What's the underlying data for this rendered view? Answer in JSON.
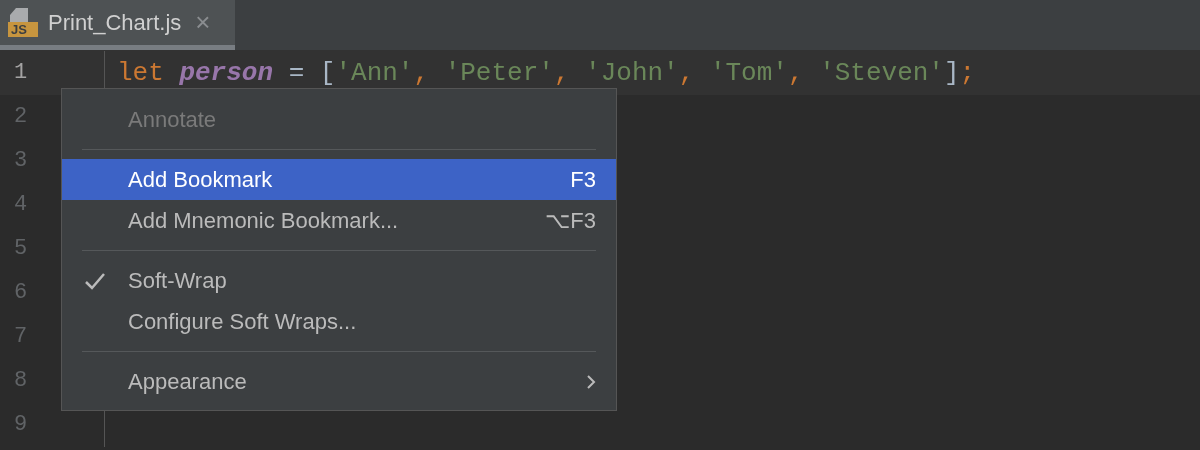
{
  "tabs": [
    {
      "badge": "JS",
      "label": "Print_Chart.js",
      "selected": true,
      "close": "×"
    }
  ],
  "editor": {
    "lines": [
      {
        "number": "1",
        "current": true,
        "tokens": [
          {
            "kind": "keyword",
            "text": "let"
          },
          {
            "kind": "variable",
            "text": "person"
          },
          {
            "kind": "operator",
            "text": "="
          },
          {
            "kind": "bracket",
            "text": "["
          },
          {
            "kind": "string",
            "text": "'Ann'"
          },
          {
            "kind": "comma",
            "text": ","
          },
          {
            "kind": "string",
            "text": "'Peter'"
          },
          {
            "kind": "comma",
            "text": ","
          },
          {
            "kind": "string",
            "text": "'John'"
          },
          {
            "kind": "comma",
            "text": ","
          },
          {
            "kind": "string",
            "text": "'Tom'"
          },
          {
            "kind": "comma",
            "text": ","
          },
          {
            "kind": "string",
            "text": "'Steven'"
          },
          {
            "kind": "bracket",
            "text": "]"
          },
          {
            "kind": "semicolon",
            "text": ";"
          }
        ]
      },
      {
        "number": "2",
        "current": false
      },
      {
        "number": "3",
        "current": false
      },
      {
        "number": "4",
        "current": false
      },
      {
        "number": "5",
        "current": false
      },
      {
        "number": "6",
        "current": false
      },
      {
        "number": "7",
        "current": false
      },
      {
        "number": "8",
        "current": false
      },
      {
        "number": "9",
        "current": false
      }
    ]
  },
  "context_menu": {
    "items": [
      {
        "kind": "item",
        "label": "Annotate",
        "disabled": true,
        "selected": false,
        "checked": false,
        "submenu": false
      },
      {
        "kind": "separator"
      },
      {
        "kind": "item",
        "label": "Add Bookmark",
        "shortcut": "F3",
        "disabled": false,
        "selected": true,
        "checked": false,
        "submenu": false
      },
      {
        "kind": "item",
        "label": "Add Mnemonic Bookmark...",
        "shortcut": "⌥F3",
        "disabled": false,
        "selected": false,
        "checked": false,
        "submenu": false
      },
      {
        "kind": "separator"
      },
      {
        "kind": "item",
        "label": "Soft-Wrap",
        "disabled": false,
        "selected": false,
        "checked": true,
        "submenu": false
      },
      {
        "kind": "item",
        "label": "Configure Soft Wraps...",
        "disabled": false,
        "selected": false,
        "checked": false,
        "submenu": false
      },
      {
        "kind": "separator"
      },
      {
        "kind": "item",
        "label": "Appearance",
        "disabled": false,
        "selected": false,
        "checked": false,
        "submenu": true
      }
    ]
  }
}
